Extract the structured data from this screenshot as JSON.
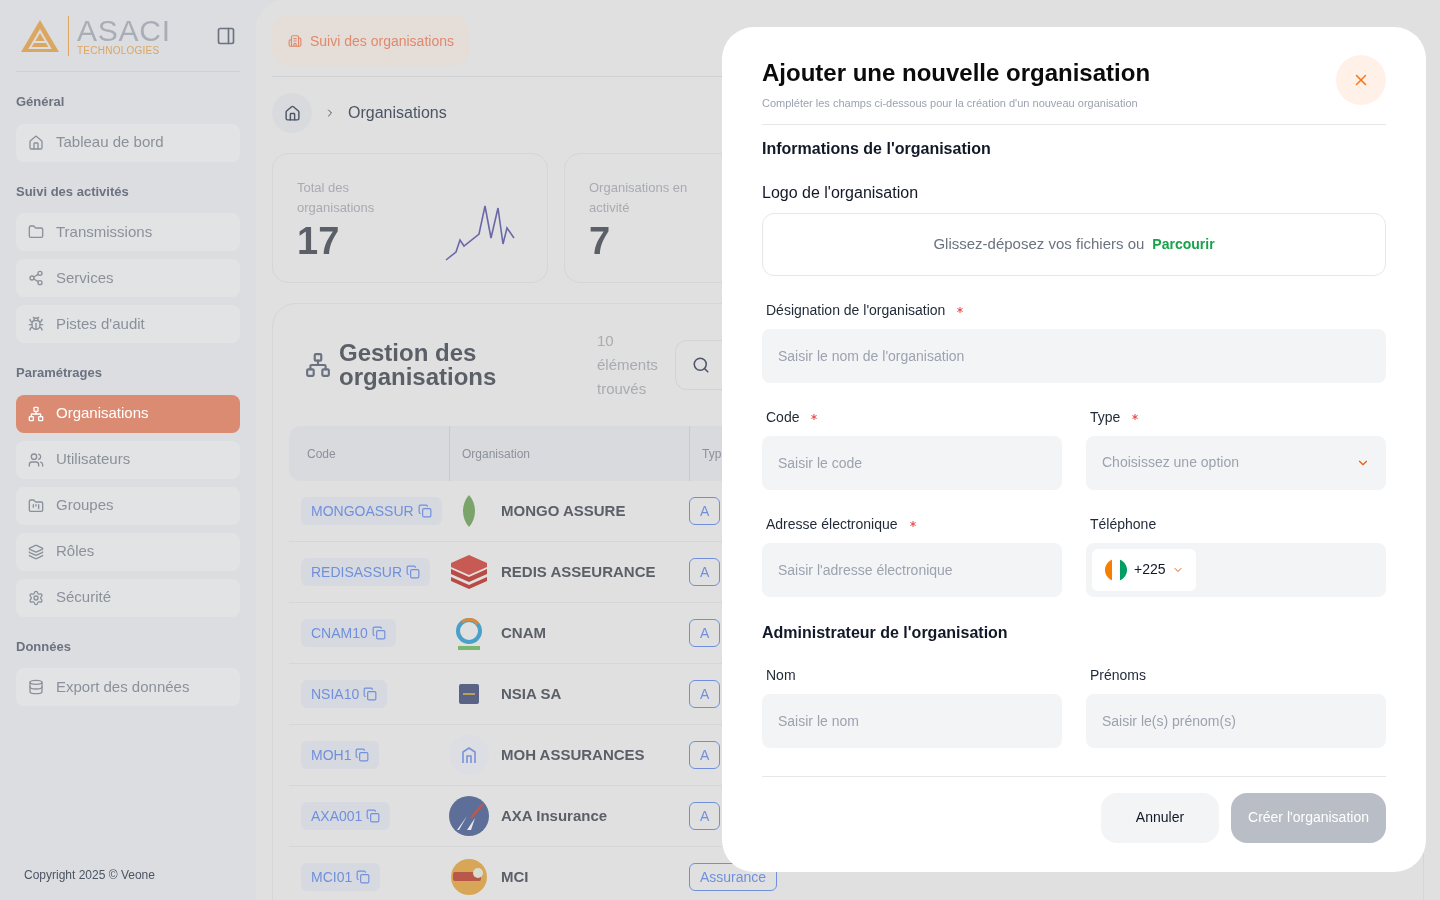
{
  "sidebar": {
    "logo": {
      "name": "ASACI",
      "tagline": "TECHNOLOGIES"
    },
    "groups": [
      {
        "title": "Général",
        "items": [
          {
            "label": "Tableau de bord",
            "selected": false
          }
        ]
      },
      {
        "title": "Suivi des activités",
        "items": [
          {
            "label": "Transmissions",
            "selected": false
          },
          {
            "label": "Services",
            "selected": false
          },
          {
            "label": "Pistes d'audit",
            "selected": false
          }
        ]
      },
      {
        "title": "Paramétrages",
        "items": [
          {
            "label": "Organisations",
            "selected": true
          },
          {
            "label": "Utilisateurs",
            "selected": false
          },
          {
            "label": "Groupes",
            "selected": false
          },
          {
            "label": "Rôles",
            "selected": false
          },
          {
            "label": "Sécurité",
            "selected": false
          }
        ]
      },
      {
        "title": "Données",
        "items": [
          {
            "label": "Export des données",
            "selected": false
          }
        ]
      }
    ],
    "copyright": "Copyright 2025 © Veone"
  },
  "header": {
    "tab": "Suivi des organisations"
  },
  "breadcrumb": [
    "Organisations"
  ],
  "stats": [
    {
      "label": "Total des organisations",
      "value": "17"
    },
    {
      "label": "Organisations en activité",
      "value": "7"
    }
  ],
  "list": {
    "title": "Gestion des organisations",
    "count": "10 éléments trouvés",
    "columns": [
      "Code",
      "Organisation",
      "Typ"
    ],
    "rows": [
      {
        "code": "MONGOASSUR",
        "name": "MONGO ASSURE",
        "type": "A"
      },
      {
        "code": "REDISASSUR",
        "name": "REDIS ASSEURANCE",
        "type": "A"
      },
      {
        "code": "CNAM10",
        "name": "CNAM",
        "type": "A"
      },
      {
        "code": "NSIA10",
        "name": "NSIA SA",
        "type": "A"
      },
      {
        "code": "MOH1",
        "name": "MOH ASSURANCES",
        "type": "A"
      },
      {
        "code": "AXA001",
        "name": "AXA Insurance",
        "type": "A"
      },
      {
        "code": "MCI01",
        "name": "MCI",
        "type": "Assurance"
      }
    ]
  },
  "modal": {
    "title": "Ajouter une nouvelle organisation",
    "subtitle": "Compléter les champs ci-dessous pour la création d'un nouveau organisation",
    "sections": [
      {
        "title": "Informations de l'organisation",
        "rows": [
          [
            {
              "kind": "upload",
              "label": "Logo de l'organisation",
              "text": "Glissez-déposez vos fichiers ou",
              "link": "Parcourir"
            }
          ],
          [
            {
              "kind": "text",
              "label": "Désignation de l'organisation",
              "required": true,
              "placeholder": "Saisir le nom de l'organisation"
            }
          ],
          [
            {
              "kind": "text",
              "label": "Code",
              "required": true,
              "placeholder": "Saisir le code"
            },
            {
              "kind": "select",
              "label": "Type",
              "required": true,
              "placeholder": "Choisissez une option"
            }
          ],
          [
            {
              "kind": "text",
              "label": "Adresse électronique",
              "required": true,
              "placeholder": "Saisir l'adresse électronique"
            },
            {
              "kind": "phone",
              "label": "Téléphone",
              "dial_code": "+225"
            }
          ]
        ]
      },
      {
        "title": "Administrateur de l'organisation",
        "rows": [
          [
            {
              "kind": "text",
              "label": "Nom",
              "placeholder": "Saisir le nom"
            },
            {
              "kind": "text",
              "label": "Prénoms",
              "placeholder": "Saisir le(s) prénom(s)"
            }
          ]
        ]
      }
    ],
    "buttons": [
      {
        "label": "Annuler",
        "kind": "secondary",
        "disabled": false
      },
      {
        "label": "Créer l'organisation",
        "kind": "primary",
        "disabled": true
      }
    ]
  }
}
